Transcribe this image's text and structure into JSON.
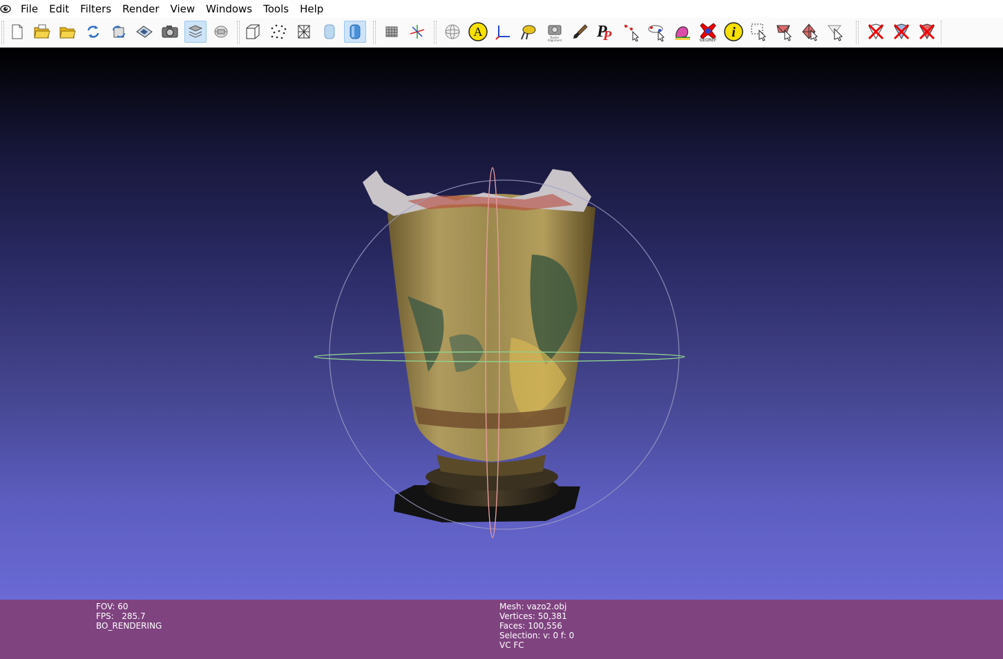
{
  "menu": {
    "items": [
      "File",
      "Edit",
      "Filters",
      "Render",
      "View",
      "Windows",
      "Tools",
      "Help"
    ]
  },
  "toolbar": {
    "icons": [
      {
        "name": "new-project-icon"
      },
      {
        "name": "open-project-icon"
      },
      {
        "name": "import-mesh-icon"
      },
      {
        "name": "reload-icon"
      },
      {
        "name": "reload-all-icon"
      },
      {
        "name": "export-mesh-icon"
      },
      {
        "name": "snapshot-icon"
      },
      {
        "name": "layer-dialog-icon",
        "active": true
      },
      {
        "name": "raster-layer-icon"
      },
      {
        "name": "bounding-box-icon"
      },
      {
        "name": "points-icon"
      },
      {
        "name": "wireframe-icon"
      },
      {
        "name": "flat-shading-icon"
      },
      {
        "name": "smooth-shading-icon",
        "active": true
      },
      {
        "name": "texture-mode-icon"
      },
      {
        "name": "axis-icon"
      },
      {
        "name": "trackball-icon"
      },
      {
        "name": "annotation-icon"
      },
      {
        "name": "measure-icon"
      },
      {
        "name": "align-icon"
      },
      {
        "name": "raster-alignment-icon",
        "label": "Raster Alignment"
      },
      {
        "name": "paint-icon"
      },
      {
        "name": "pickpoints-icon"
      },
      {
        "name": "point-picking-icon"
      },
      {
        "name": "manipulator-icon"
      },
      {
        "name": "texture-paint-icon"
      },
      {
        "name": "georef-icon",
        "label": "GEOREF"
      },
      {
        "name": "info-icon"
      },
      {
        "name": "select-vertices-icon"
      },
      {
        "name": "select-faces-icon"
      },
      {
        "name": "select-connected-icon"
      },
      {
        "name": "select-pointer-icon"
      },
      {
        "name": "delete-vertices-icon"
      },
      {
        "name": "delete-faces-icon"
      },
      {
        "name": "delete-all-icon"
      }
    ]
  },
  "colors": {
    "info_bar": "#7f4380",
    "viewport_top": "#000000",
    "viewport_bottom": "#6b6ad6",
    "trackball_horizontal": "#8fd18f",
    "trackball_vertical": "#e89a9a",
    "trackball_circle": "#a0a0c8"
  },
  "status": {
    "left": {
      "fov": "FOV: 60",
      "fps": "FPS:   285.7",
      "mode": "BO_RENDERING"
    },
    "right": {
      "mesh": "Mesh: vazo2.obj",
      "vertices": "Vertices: 50,381",
      "faces": "Faces: 100,556",
      "selection": "Selection: v: 0 f: 0",
      "flags": "VC FC"
    }
  }
}
